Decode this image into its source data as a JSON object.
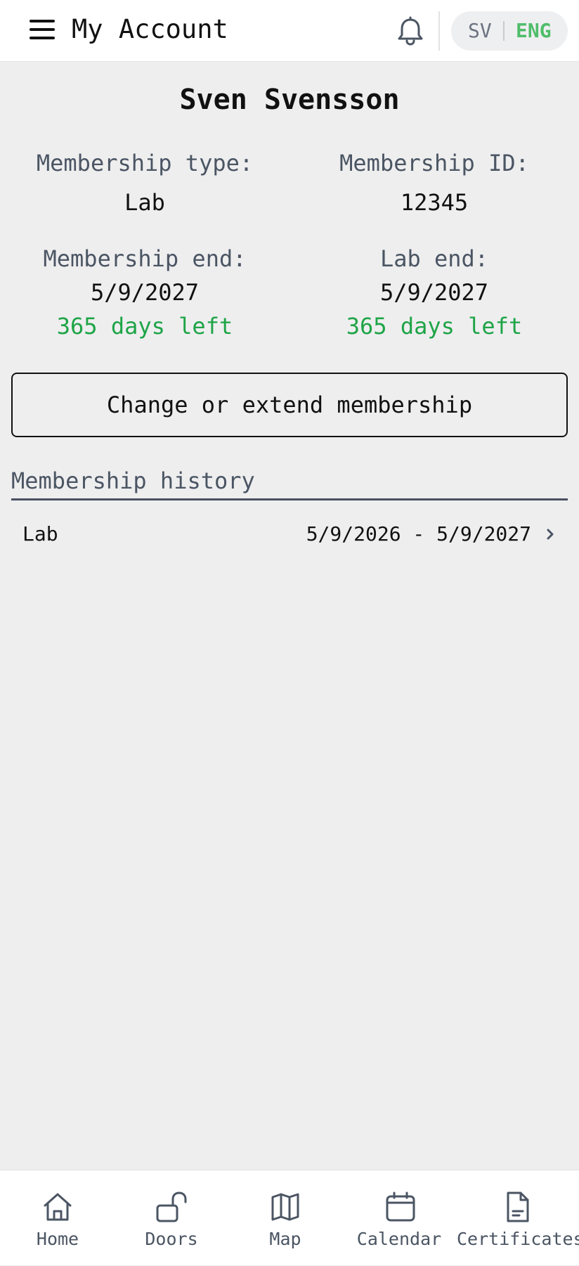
{
  "header": {
    "title": "My Account",
    "menu_icon": "hamburger-menu-icon",
    "notification_icon": "bell-icon",
    "languages": {
      "sv": "SV",
      "eng": "ENG",
      "active": "ENG"
    }
  },
  "profile": {
    "name": "Sven Svensson",
    "membership_type_label": "Membership type:",
    "membership_type": "Lab",
    "membership_id_label": "Membership ID:",
    "membership_id": "12345",
    "membership_end_label": "Membership end:",
    "membership_end": "5/9/2027",
    "membership_days_left": "365 days left",
    "lab_end_label": "Lab end:",
    "lab_end": "5/9/2027",
    "lab_days_left": "365 days left"
  },
  "actions": {
    "extend_label": "Change or extend membership"
  },
  "history": {
    "heading": "Membership history",
    "rows": [
      {
        "type": "Lab",
        "period": "5/9/2026 - 5/9/2027"
      }
    ]
  },
  "nav": {
    "items": [
      {
        "label": "Home",
        "icon": "home-icon"
      },
      {
        "label": "Doors",
        "icon": "unlocked-padlock-icon"
      },
      {
        "label": "Map",
        "icon": "map-icon"
      },
      {
        "label": "Calendar",
        "icon": "calendar-icon"
      },
      {
        "label": "Certificates",
        "icon": "document-icon"
      }
    ]
  },
  "colors": {
    "accent_green": "#1ea446",
    "active_language": "#4fbd6a",
    "muted_text": "#4b5563",
    "background": "#eeeeef"
  }
}
